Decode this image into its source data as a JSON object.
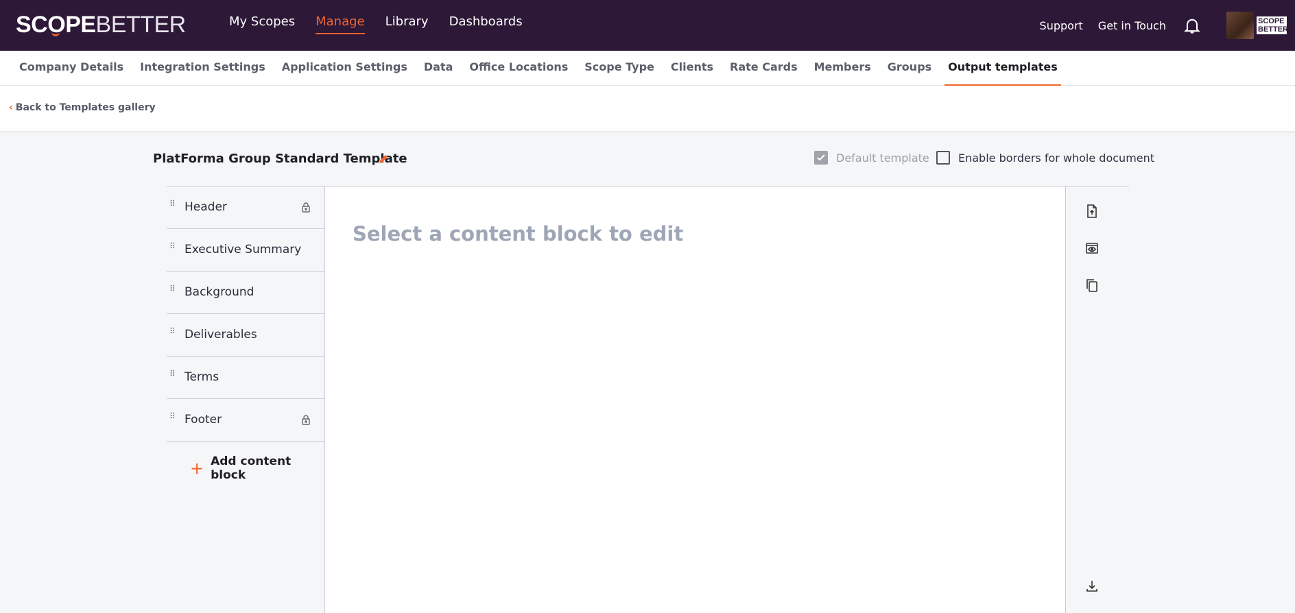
{
  "brand": {
    "logo_part1": "SC",
    "logo_o": "O",
    "logo_part2": "PE",
    "logo_part3": "BETTER",
    "mini_logo": "SCOPE BETTER",
    "accent": "#f0642d",
    "topbar_bg": "#2d1838"
  },
  "main_nav": [
    {
      "label": "My Scopes"
    },
    {
      "label": "Manage"
    },
    {
      "label": "Library"
    },
    {
      "label": "Dashboards"
    }
  ],
  "header_right": {
    "support": "Support",
    "contact": "Get in Touch"
  },
  "sub_nav": [
    {
      "label": "Company Details"
    },
    {
      "label": "Integration Settings"
    },
    {
      "label": "Application Settings"
    },
    {
      "label": "Data"
    },
    {
      "label": "Office Locations"
    },
    {
      "label": "Scope Type"
    },
    {
      "label": "Clients"
    },
    {
      "label": "Rate Cards"
    },
    {
      "label": "Members"
    },
    {
      "label": "Groups"
    },
    {
      "label": "Output templates"
    }
  ],
  "back_link": "Back to Templates gallery",
  "template": {
    "title": "PlatForma Group Standard Template",
    "default_label": "Default template",
    "borders_label": "Enable borders for whole document"
  },
  "blocks": [
    {
      "label": "Header",
      "locked": true
    },
    {
      "label": "Executive Summary",
      "locked": false
    },
    {
      "label": "Background",
      "locked": false
    },
    {
      "label": "Deliverables",
      "locked": false
    },
    {
      "label": "Terms",
      "locked": false
    },
    {
      "label": "Footer",
      "locked": true
    }
  ],
  "add_block": "Add content block",
  "canvas_hint": "Select a content block to edit"
}
